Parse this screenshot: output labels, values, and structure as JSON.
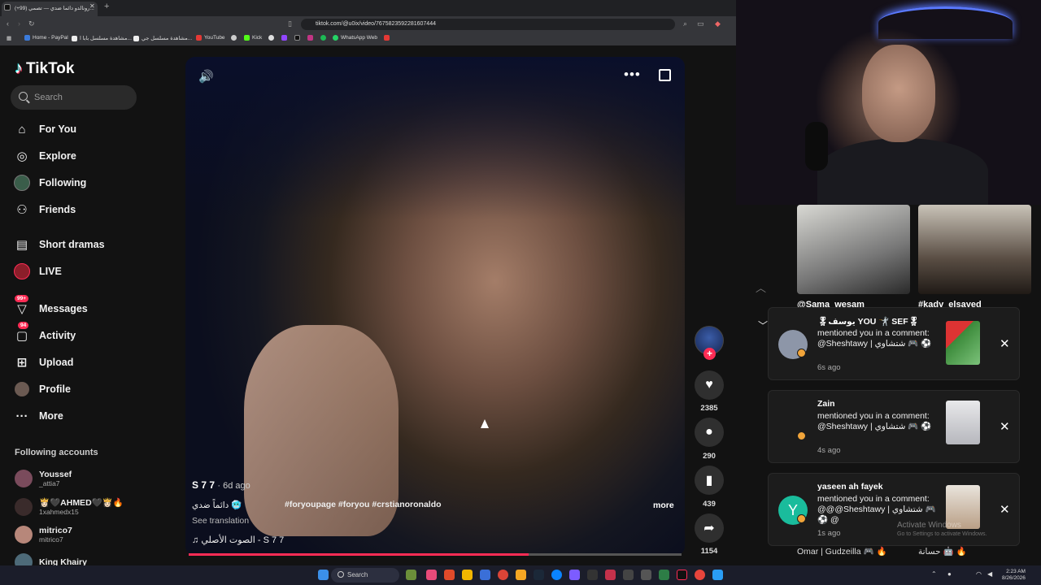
{
  "browser": {
    "tab_title": "(+99) رونالدو دائما ضدي — تصمي...",
    "tab_close": "✕",
    "new_tab": "+",
    "url": "tiktok.com/@u0ix/video/7675823592281607444",
    "bookmarks": [
      "Home - PayPal",
      "مشاهدة مسلسل بابا ا...",
      "مشاهدة مسلسل جي...",
      "YouTube",
      "Kick",
      "WhatsApp Web"
    ]
  },
  "sidebar": {
    "logo": "TikTok",
    "search_placeholder": "Search",
    "nav": [
      {
        "label": "For You",
        "icon": "home-icon"
      },
      {
        "label": "Explore",
        "icon": "compass-icon"
      },
      {
        "label": "Following",
        "icon": "following-avatar-icon"
      },
      {
        "label": "Friends",
        "icon": "friends-icon"
      },
      {
        "label": "Short dramas",
        "icon": "film-icon"
      },
      {
        "label": "LIVE",
        "icon": "live-icon"
      },
      {
        "label": "Messages",
        "icon": "message-icon",
        "badge": "99+"
      },
      {
        "label": "Activity",
        "icon": "activity-icon",
        "badge": "94"
      },
      {
        "label": "Upload",
        "icon": "upload-icon"
      },
      {
        "label": "Profile",
        "icon": "profile-avatar-icon"
      },
      {
        "label": "More",
        "icon": "more-dots-icon"
      }
    ],
    "following_title": "Following accounts",
    "accounts": [
      {
        "name": "Youssef",
        "handle": "_attia7"
      },
      {
        "name": "👸🏻🖤AHMED🖤👸🏻🔥",
        "handle": "1xahmedx15"
      },
      {
        "name": "mitrico7",
        "handle": "mitrico7"
      },
      {
        "name": "King Khairy",
        "handle": ""
      }
    ]
  },
  "video": {
    "author": "S 7 7",
    "ago": "· 6d ago",
    "description": "دائماً ضدي 🥶",
    "hashtags": "#foryoupage #foryou #crstianoronaldo",
    "more": "more",
    "translation": "See translation",
    "sound": "♫  الصوت الأصلي - S 7 7",
    "progress": 0.69
  },
  "actions": {
    "follow_plus": "+",
    "likes": "2385",
    "comments": "290",
    "saves": "439",
    "shares": "1154"
  },
  "right": {
    "thumb_names": [
      "@Sama_wesam",
      "#kady_elsayed"
    ],
    "notifications": [
      {
        "title": "🎖يوسف YOU 🤺 SEF🎖",
        "body": "mentioned you in a comment: @Sheshtawy | شتشاوي 🎮 ⚽",
        "time": "6s ago"
      },
      {
        "title": "Zain",
        "body": "mentioned you in a comment: @Sheshtawy | شتشاوي 🎮 ⚽",
        "time": "4s ago"
      },
      {
        "title": "yaseen ah fayek",
        "body": "mentioned you in a comment: @@@Sheshtawy | شتشاوي 🎮 ⚽ @",
        "time": "1s ago",
        "avatar_letter": "Y"
      }
    ],
    "bottom_names": [
      "Omar | Gudzeilla 🎮 🔥",
      "حسانة 🤖 🔥"
    ],
    "watermark": "Activate Windows",
    "watermark_sub": "Go to Settings to activate Windows."
  },
  "taskbar": {
    "search": "Search",
    "time": "2:23 AM",
    "date": "8/26/2026"
  },
  "colors": {
    "accent": "#fe2c55",
    "teal": "#25f4ee",
    "background": "#121212"
  }
}
